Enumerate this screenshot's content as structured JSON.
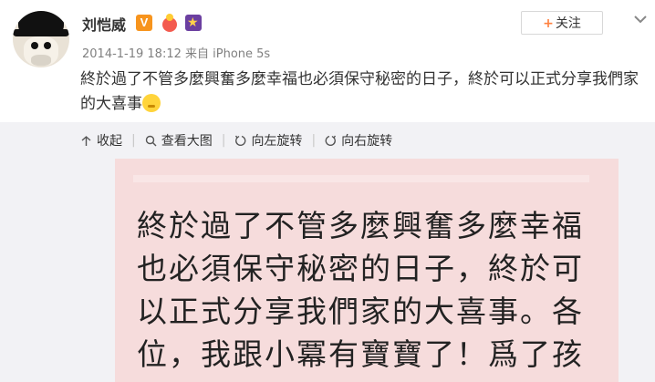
{
  "post": {
    "username": "刘恺威",
    "verified_badge": "V",
    "meta": "2014-1-19 18:12 来自 iPhone 5s",
    "text": "終於過了不管多麼興奮多麼幸福也必須保守秘密的日子，終於可以正式分享我們家的大喜事",
    "follow_label": "关注"
  },
  "toolbar": {
    "collapse_label": "收起",
    "view_large_label": "查看大图",
    "rotate_left_label": "向左旋转",
    "rotate_right_label": "向右旋转"
  },
  "image": {
    "lines": [
      "終於過了不管多麼興奮多麼幸福",
      "也必須保守秘密的日子，終於可",
      "以正式分享我們家的大喜事。各",
      "位，我跟小冪有寶寶了！爲了孩"
    ]
  },
  "colors": {
    "accent": "#ff8140",
    "media_bg": "#f2f2f5",
    "image_bg": "#f6dcdc"
  }
}
